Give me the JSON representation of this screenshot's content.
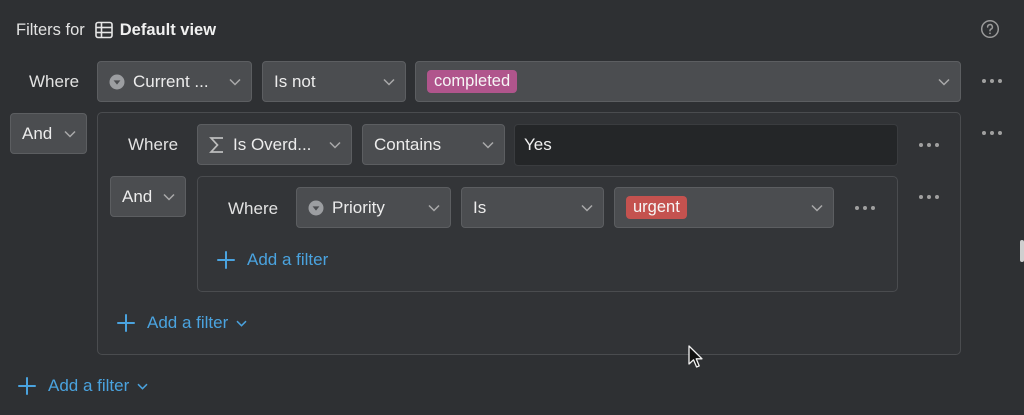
{
  "header": {
    "prefix": "Filters for",
    "view_name": "Default view"
  },
  "root": {
    "where_label": "Where",
    "field": "Current ...",
    "operator": "Is not",
    "value_tag": "completed",
    "conjunction": "And",
    "add_filter": "Add a filter"
  },
  "group1": {
    "where_label": "Where",
    "field": "Is Overd...",
    "operator": "Contains",
    "value": "Yes",
    "conjunction": "And",
    "add_filter": "Add a filter"
  },
  "group2": {
    "where_label": "Where",
    "field": "Priority",
    "operator": "Is",
    "value_tag": "urgent",
    "add_filter": "Add a filter"
  },
  "colors": {
    "background": "#2e3033",
    "accent": "#4aa3df",
    "tag_completed": "#b0558c",
    "tag_urgent": "#c4524f"
  },
  "icons": {
    "view": "table-icon",
    "help": "help-circle-icon",
    "status_field": "status-icon",
    "formula_field": "sigma-icon",
    "select_field": "select-icon",
    "more": "more-icon",
    "add": "plus-icon",
    "dropdown": "chevron-down-icon",
    "cursor": "mouse-cursor-icon"
  }
}
